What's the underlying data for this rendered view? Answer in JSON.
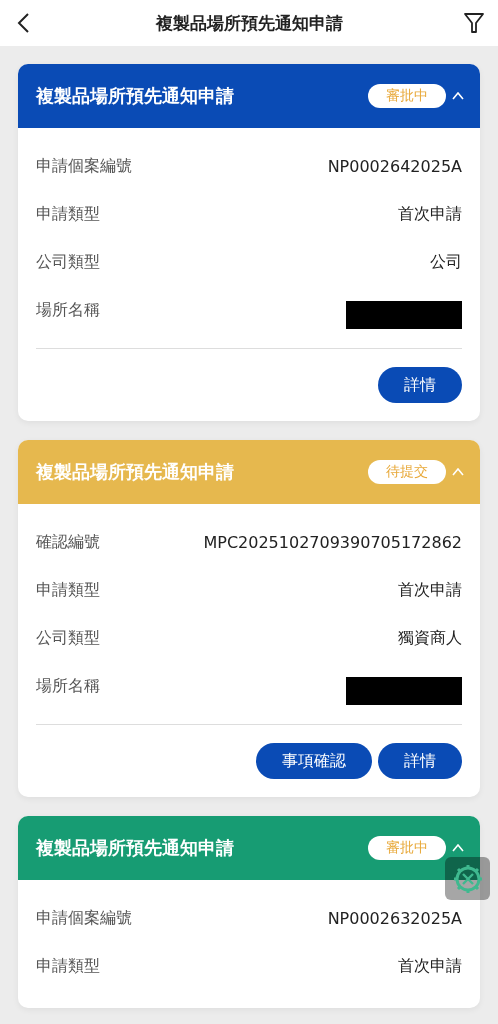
{
  "nav": {
    "title": "複製品場所預先通知申請"
  },
  "cards": [
    {
      "title": "複製品場所預先通知申請",
      "color": "#0a4bb5",
      "status": "審批中",
      "expanded": true,
      "fields": [
        {
          "label": "申請個案編號",
          "value": "NP0002642025A"
        },
        {
          "label": "申請類型",
          "value": "首次申請"
        },
        {
          "label": "公司類型",
          "value": "公司"
        },
        {
          "label": "場所名稱",
          "redacted": true
        }
      ],
      "buttons": [
        "詳情"
      ]
    },
    {
      "title": "複製品場所預先通知申請",
      "color": "#e6b84e",
      "status": "待提交",
      "expanded": true,
      "fields": [
        {
          "label": "確認編號",
          "value": "MPC2025102709390705172862"
        },
        {
          "label": "申請類型",
          "value": "首次申請"
        },
        {
          "label": "公司類型",
          "value": "獨資商人"
        },
        {
          "label": "場所名稱",
          "redacted": true
        }
      ],
      "buttons": [
        "事項確認",
        "詳情"
      ]
    },
    {
      "title": "複製品場所預先通知申請",
      "color": "#179c73",
      "status": "審批中",
      "expanded": true,
      "fields": [
        {
          "label": "申請個案編號",
          "value": "NP0002632025A"
        },
        {
          "label": "申請類型",
          "value": "首次申請"
        }
      ]
    }
  ]
}
